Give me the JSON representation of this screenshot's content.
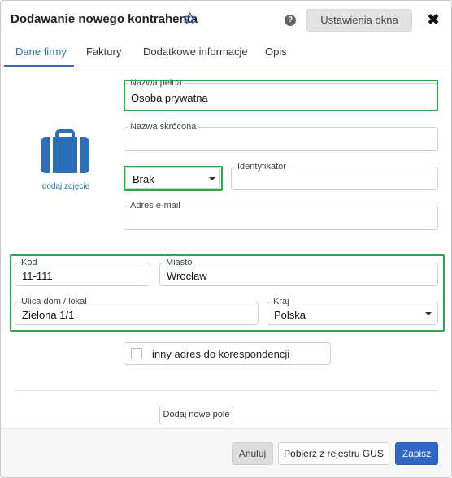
{
  "dialog": {
    "title": "Dodawanie nowego kontrahenta",
    "settings_label": "Ustawienia okna",
    "help_glyph": "?",
    "close_glyph": "✖"
  },
  "tabs": [
    {
      "label": "Dane firmy",
      "active": true
    },
    {
      "label": "Faktury",
      "active": false
    },
    {
      "label": "Dodatkowe informacje",
      "active": false
    },
    {
      "label": "Opis",
      "active": false
    }
  ],
  "photo": {
    "add_label": "dodaj zdjęcie"
  },
  "form": {
    "full_name": {
      "label": "Nazwa pełna",
      "value": "Osoba prywatna"
    },
    "short_name": {
      "label": "Nazwa skrócona",
      "value": ""
    },
    "type_select": {
      "value": "Brak"
    },
    "identifier": {
      "label": "Identyfikator",
      "value": ""
    },
    "email": {
      "label": "Adres e-mail",
      "value": ""
    },
    "postal_code": {
      "label": "Kod",
      "value": "11-111"
    },
    "city": {
      "label": "Miasto",
      "value": "Wrocław"
    },
    "street": {
      "label": "Ulica dom / lokal",
      "value": "Zielona 1/1"
    },
    "country": {
      "label": "Kraj",
      "value": "Polska"
    },
    "other_address": {
      "label": "inny adres do korespondencji",
      "checked": false
    }
  },
  "add_field_label": "Dodaj nowe pole",
  "footer": {
    "cancel_label": "Anuluj",
    "gus_label": "Pobierz z rejestru GUS",
    "save_label": "Zapisz"
  },
  "colors": {
    "accent": "#2c6fb6",
    "highlight": "#2aa84a",
    "save_button": "#2f66c7"
  }
}
